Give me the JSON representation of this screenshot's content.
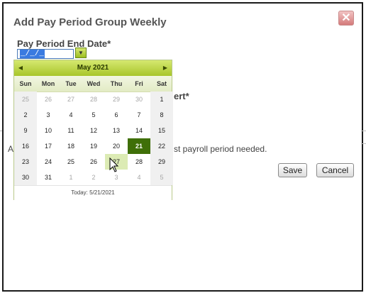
{
  "dialog": {
    "title": "Add Pay Period Group Weekly",
    "close_glyph": "✕",
    "field_label": "Pay Period End Date*",
    "date_value": "_/_/_",
    "second_label_fragment": "ert*",
    "info_text_fragment": "st payroll period needed.",
    "left_fragment": "A",
    "save_label": "Save",
    "cancel_label": "Cancel",
    "picker_icon": "calendar-dropdown-icon"
  },
  "calendar": {
    "month_label": "May 2021",
    "prev_glyph": "◀",
    "next_glyph": "▶",
    "weekdays": [
      "Sun",
      "Mon",
      "Tue",
      "Wed",
      "Thu",
      "Fri",
      "Sat"
    ],
    "weeks": [
      [
        {
          "d": "25",
          "o": true
        },
        {
          "d": "26",
          "o": true
        },
        {
          "d": "27",
          "o": true
        },
        {
          "d": "28",
          "o": true
        },
        {
          "d": "29",
          "o": true
        },
        {
          "d": "30",
          "o": true
        },
        {
          "d": "1"
        }
      ],
      [
        {
          "d": "2"
        },
        {
          "d": "3"
        },
        {
          "d": "4"
        },
        {
          "d": "5"
        },
        {
          "d": "6"
        },
        {
          "d": "7"
        },
        {
          "d": "8"
        }
      ],
      [
        {
          "d": "9"
        },
        {
          "d": "10"
        },
        {
          "d": "11"
        },
        {
          "d": "12"
        },
        {
          "d": "13"
        },
        {
          "d": "14"
        },
        {
          "d": "15"
        }
      ],
      [
        {
          "d": "16"
        },
        {
          "d": "17"
        },
        {
          "d": "18"
        },
        {
          "d": "19"
        },
        {
          "d": "20"
        },
        {
          "d": "21",
          "s": true
        },
        {
          "d": "22"
        }
      ],
      [
        {
          "d": "23"
        },
        {
          "d": "24"
        },
        {
          "d": "25"
        },
        {
          "d": "26"
        },
        {
          "d": "27",
          "h": true
        },
        {
          "d": "28"
        },
        {
          "d": "29"
        }
      ],
      [
        {
          "d": "30"
        },
        {
          "d": "31"
        },
        {
          "d": "1",
          "o": true
        },
        {
          "d": "2",
          "o": true
        },
        {
          "d": "3",
          "o": true
        },
        {
          "d": "4",
          "o": true
        },
        {
          "d": "5",
          "o": true
        }
      ]
    ],
    "today_label": "Today: 5/21/2021",
    "colors": {
      "header": "#a8c62a",
      "selected": "#3f6f08",
      "hover": "#dcebb4"
    }
  }
}
